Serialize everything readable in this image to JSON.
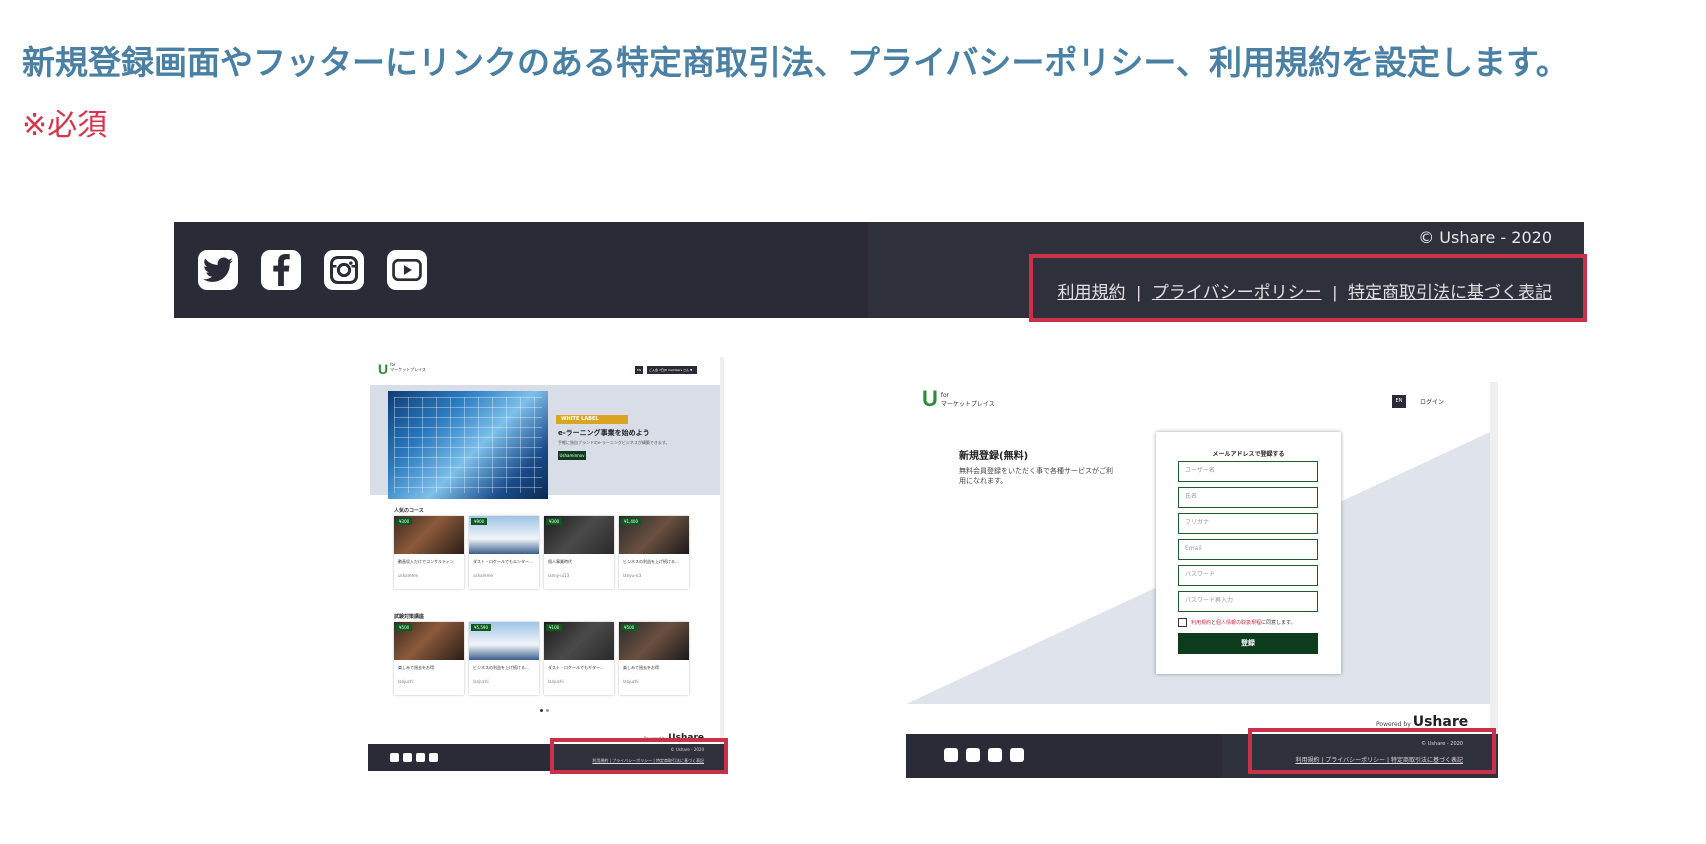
{
  "heading": "新規登録画面やフッターにリンクのある特定商取引法、プライバシーポリシー、利用規約を設定します。",
  "required_note": "※必須",
  "banner": {
    "copyright": "© Ushare - 2020",
    "links": [
      "利用規約",
      "プライバシーポリシー",
      "特定商取引法に基づく表記"
    ],
    "separator": "|",
    "social_icons": [
      "twitter-icon",
      "facebook-icon",
      "instagram-icon",
      "youtube-icon"
    ],
    "bg_color": "#2a2b36",
    "highlight_color": "#c9304a"
  },
  "left_mock": {
    "logo_u": "U",
    "logo_line1": "for",
    "logo_line2": "マーケットプレイス",
    "en_label": "EN",
    "user_label": "ご入会 7日(6 members さん ▼",
    "hero_badge": "WHITE LABEL",
    "hero_title": "e-ラーニング事業を始めよう",
    "hero_sub": "手軽に独自ブランドのe-ラーニングビジネスが構築できます。",
    "hero_button": "Ushareinnov",
    "section1": "人気のコース",
    "section2": "試験対策講座",
    "cards_row1": [
      {
        "price": "¥300",
        "title": "動画収入だけでコンサルティン",
        "author": "ushareme"
      },
      {
        "price": "¥900",
        "title": "ダスト・ロケールでもエンター...",
        "author": "ushareme"
      },
      {
        "price": "¥300",
        "title": "個人事業時代",
        "author": "lanny-ui13"
      },
      {
        "price": "¥1,400",
        "title": "ビジネスの利益を上げ続ける...",
        "author": "lanyu-ic3"
      }
    ],
    "cards_row2": [
      {
        "price": "¥500",
        "title": "楽しみで過去をお得",
        "author": "lanjuchi"
      },
      {
        "price": "¥5,590",
        "title": "ビジネスの利益を上げ続ける...",
        "author": "lanjuchi"
      },
      {
        "price": "¥100",
        "title": "ダスト・ロケールでもギター...",
        "author": "lanjuchi"
      },
      {
        "price": "¥500",
        "title": "楽しみで過去をお得",
        "author": "lanjuchi"
      }
    ],
    "powered": "Powered by",
    "powered_brand": "Ushare",
    "copyright": "© Ushare - 2020",
    "footer_links": "利用規約 | プライバシーポリシー | 特定商取引法に基づく表記"
  },
  "right_mock": {
    "logo_u": "U",
    "logo_line1": "for",
    "logo_line2": "マーケットプレイス",
    "en_label": "EN",
    "login_label": "ログイン",
    "reg_title": "新規登録(無料)",
    "reg_desc": "無料会員登録をいただく事で各種サービスがご利用になれます。",
    "form_title": "メールアドレスで登録する",
    "fields": [
      "ユーザー名",
      "氏名",
      "フリガナ",
      "Email",
      "パスワード",
      "パスワード再入力"
    ],
    "agree_link1": "利用規約",
    "agree_mid": "と",
    "agree_link2": "個人情報の取扱規程",
    "agree_tail": "に同意します。",
    "submit": "登録",
    "powered": "Powered by",
    "powered_brand": "Ushare",
    "copyright": "© Ushare - 2020",
    "footer_links": "利用規約 | プライバシーポリシー | 特定商取引法に基づく表記"
  }
}
